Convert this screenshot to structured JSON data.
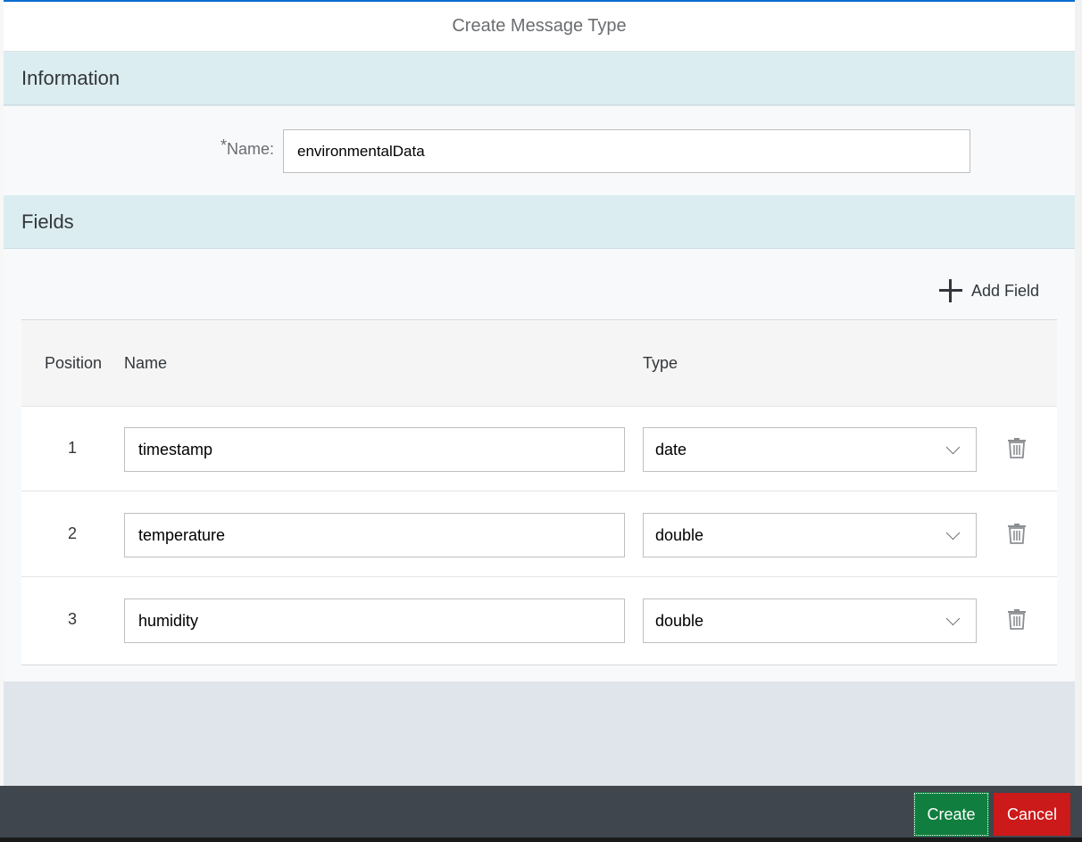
{
  "dialog": {
    "title": "Create Message Type"
  },
  "information": {
    "header": "Information",
    "name_required_mark": "*",
    "name_label": "Name:",
    "name_value": "environmentalData"
  },
  "fields": {
    "header": "Fields",
    "add_field_label": "Add Field",
    "columns": {
      "position": "Position",
      "name": "Name",
      "type": "Type"
    },
    "rows": [
      {
        "position": "1",
        "name": "timestamp",
        "type": "date"
      },
      {
        "position": "2",
        "name": "temperature",
        "type": "double"
      },
      {
        "position": "3",
        "name": "humidity",
        "type": "double"
      }
    ]
  },
  "footer": {
    "create_label": "Create",
    "cancel_label": "Cancel"
  },
  "colors": {
    "accent": "#0a6ed1",
    "section_header_bg": "#dcedf1",
    "create_button": "#107e3e",
    "cancel_button": "#cc1919",
    "footer_bg": "#3f464d"
  },
  "icons": {
    "add": "plus-icon",
    "delete": "trash-icon",
    "dropdown": "chevron-down-icon"
  }
}
